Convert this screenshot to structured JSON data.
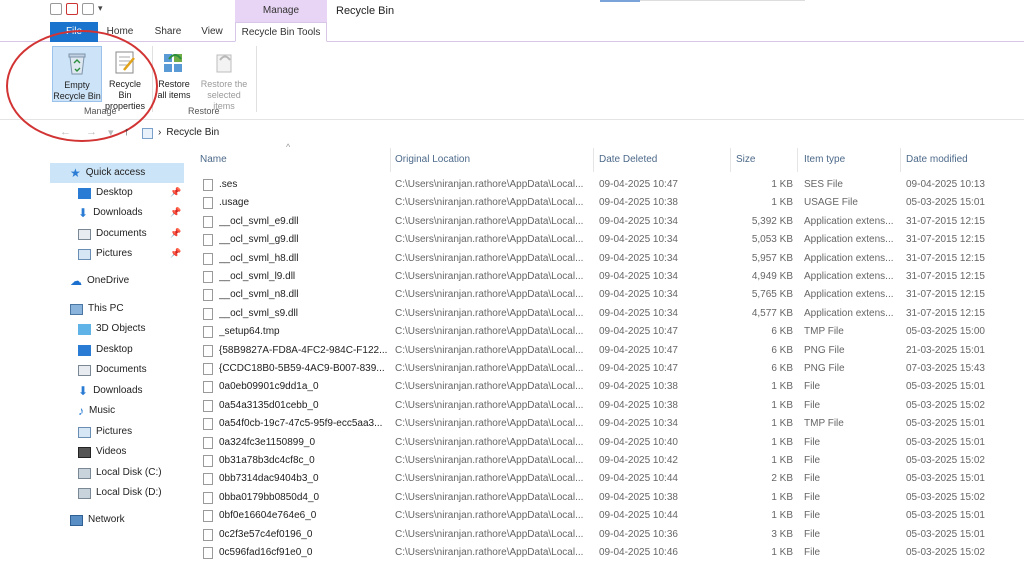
{
  "window": {
    "title": "Recycle Bin",
    "context_tab": "Manage"
  },
  "tabs": {
    "file": "File",
    "home": "Home",
    "share": "Share",
    "view": "View",
    "rbt": "Recycle Bin Tools"
  },
  "ribbon": {
    "empty_l1": "Empty",
    "empty_l2": "Recycle Bin",
    "props_l1": "Recycle Bin",
    "props_l2": "properties",
    "restall_l1": "Restore",
    "restall_l2": "all items",
    "restsel_l1": "Restore the",
    "restsel_l2": "selected items",
    "group_manage": "Manage",
    "group_restore": "Restore"
  },
  "address": {
    "path": "Recycle Bin"
  },
  "sidebar": {
    "quick_access": "Quick access",
    "desktop": "Desktop",
    "downloads": "Downloads",
    "documents": "Documents",
    "pictures": "Pictures",
    "onedrive": "OneDrive",
    "this_pc": "This PC",
    "objects3d": "3D Objects",
    "desktop2": "Desktop",
    "documents2": "Documents",
    "downloads2": "Downloads",
    "music": "Music",
    "pictures2": "Pictures",
    "videos": "Videos",
    "disk_c": "Local Disk (C:)",
    "disk_d": "Local Disk (D:)",
    "network": "Network"
  },
  "columns": {
    "name": "Name",
    "loc": "Original Location",
    "deleted": "Date Deleted",
    "size": "Size",
    "type": "Item type",
    "modified": "Date modified"
  },
  "files": [
    {
      "name": ".ses",
      "loc": "C:\\Users\\niranjan.rathore\\AppData\\Local...",
      "deleted": "09-04-2025 10:47",
      "size": "1 KB",
      "type": "SES File",
      "modified": "09-04-2025 10:13"
    },
    {
      "name": ".usage",
      "loc": "C:\\Users\\niranjan.rathore\\AppData\\Local...",
      "deleted": "09-04-2025 10:38",
      "size": "1 KB",
      "type": "USAGE File",
      "modified": "05-03-2025 15:01"
    },
    {
      "name": "__ocl_svml_e9.dll",
      "loc": "C:\\Users\\niranjan.rathore\\AppData\\Local...",
      "deleted": "09-04-2025 10:34",
      "size": "5,392 KB",
      "type": "Application extens...",
      "modified": "31-07-2015 12:15"
    },
    {
      "name": "__ocl_svml_g9.dll",
      "loc": "C:\\Users\\niranjan.rathore\\AppData\\Local...",
      "deleted": "09-04-2025 10:34",
      "size": "5,053 KB",
      "type": "Application extens...",
      "modified": "31-07-2015 12:15"
    },
    {
      "name": "__ocl_svml_h8.dll",
      "loc": "C:\\Users\\niranjan.rathore\\AppData\\Local...",
      "deleted": "09-04-2025 10:34",
      "size": "5,957 KB",
      "type": "Application extens...",
      "modified": "31-07-2015 12:15"
    },
    {
      "name": "__ocl_svml_l9.dll",
      "loc": "C:\\Users\\niranjan.rathore\\AppData\\Local...",
      "deleted": "09-04-2025 10:34",
      "size": "4,949 KB",
      "type": "Application extens...",
      "modified": "31-07-2015 12:15"
    },
    {
      "name": "__ocl_svml_n8.dll",
      "loc": "C:\\Users\\niranjan.rathore\\AppData\\Local...",
      "deleted": "09-04-2025 10:34",
      "size": "5,765 KB",
      "type": "Application extens...",
      "modified": "31-07-2015 12:15"
    },
    {
      "name": "__ocl_svml_s9.dll",
      "loc": "C:\\Users\\niranjan.rathore\\AppData\\Local...",
      "deleted": "09-04-2025 10:34",
      "size": "4,577 KB",
      "type": "Application extens...",
      "modified": "31-07-2015 12:15"
    },
    {
      "name": "_setup64.tmp",
      "loc": "C:\\Users\\niranjan.rathore\\AppData\\Local...",
      "deleted": "09-04-2025 10:47",
      "size": "6 KB",
      "type": "TMP File",
      "modified": "05-03-2025 15:00"
    },
    {
      "name": "{58B9827A-FD8A-4FC2-984C-F122...",
      "loc": "C:\\Users\\niranjan.rathore\\AppData\\Local...",
      "deleted": "09-04-2025 10:47",
      "size": "6 KB",
      "type": "PNG File",
      "modified": "21-03-2025 15:01"
    },
    {
      "name": "{CCDC18B0-5B59-4AC9-B007-839...",
      "loc": "C:\\Users\\niranjan.rathore\\AppData\\Local...",
      "deleted": "09-04-2025 10:47",
      "size": "6 KB",
      "type": "PNG File",
      "modified": "07-03-2025 15:43"
    },
    {
      "name": "0a0eb09901c9dd1a_0",
      "loc": "C:\\Users\\niranjan.rathore\\AppData\\Local...",
      "deleted": "09-04-2025 10:38",
      "size": "1 KB",
      "type": "File",
      "modified": "05-03-2025 15:01"
    },
    {
      "name": "0a54a3135d01cebb_0",
      "loc": "C:\\Users\\niranjan.rathore\\AppData\\Local...",
      "deleted": "09-04-2025 10:38",
      "size": "1 KB",
      "type": "File",
      "modified": "05-03-2025 15:02"
    },
    {
      "name": "0a54f0cb-19c7-47c5-95f9-ecc5aa3...",
      "loc": "C:\\Users\\niranjan.rathore\\AppData\\Local...",
      "deleted": "09-04-2025 10:34",
      "size": "1 KB",
      "type": "TMP File",
      "modified": "05-03-2025 15:01"
    },
    {
      "name": "0a324fc3e1150899_0",
      "loc": "C:\\Users\\niranjan.rathore\\AppData\\Local...",
      "deleted": "09-04-2025 10:40",
      "size": "1 KB",
      "type": "File",
      "modified": "05-03-2025 15:01"
    },
    {
      "name": "0b31a78b3dc4cf8c_0",
      "loc": "C:\\Users\\niranjan.rathore\\AppData\\Local...",
      "deleted": "09-04-2025 10:42",
      "size": "1 KB",
      "type": "File",
      "modified": "05-03-2025 15:02"
    },
    {
      "name": "0bb7314dac9404b3_0",
      "loc": "C:\\Users\\niranjan.rathore\\AppData\\Local...",
      "deleted": "09-04-2025 10:44",
      "size": "2 KB",
      "type": "File",
      "modified": "05-03-2025 15:01"
    },
    {
      "name": "0bba0179bb0850d4_0",
      "loc": "C:\\Users\\niranjan.rathore\\AppData\\Local...",
      "deleted": "09-04-2025 10:38",
      "size": "1 KB",
      "type": "File",
      "modified": "05-03-2025 15:02"
    },
    {
      "name": "0bf0e16604e764e6_0",
      "loc": "C:\\Users\\niranjan.rathore\\AppData\\Local...",
      "deleted": "09-04-2025 10:44",
      "size": "1 KB",
      "type": "File",
      "modified": "05-03-2025 15:01"
    },
    {
      "name": "0c2f3e57c4ef0196_0",
      "loc": "C:\\Users\\niranjan.rathore\\AppData\\Local...",
      "deleted": "09-04-2025 10:36",
      "size": "3 KB",
      "type": "File",
      "modified": "05-03-2025 15:01"
    },
    {
      "name": "0c596fad16cf91e0_0",
      "loc": "C:\\Users\\niranjan.rathore\\AppData\\Local...",
      "deleted": "09-04-2025 10:46",
      "size": "1 KB",
      "type": "File",
      "modified": "05-03-2025 15:02"
    }
  ]
}
